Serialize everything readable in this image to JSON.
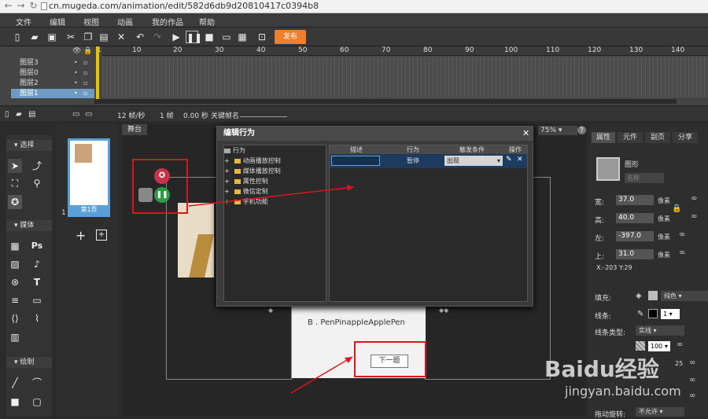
{
  "browser": {
    "url": "cn.mugeda.com/animation/edit/582d6db9d20810417c0394b8"
  },
  "menu": [
    "文件",
    "编辑",
    "视图",
    "动画",
    "我的作品",
    "帮助"
  ],
  "toolbar": {
    "publish": "发布"
  },
  "ruler": [
    "1",
    "10",
    "20",
    "30",
    "40",
    "50",
    "60",
    "70",
    "80",
    "90",
    "100",
    "110",
    "120",
    "130",
    "140"
  ],
  "layers": [
    "图层3",
    "图层0",
    "图层2",
    "图层1"
  ],
  "status": {
    "fps": "12 帧/秒",
    "frame": "1 帧",
    "time": "0.00 秒",
    "keyname": "关键帧名"
  },
  "left_panel": {
    "select": "选择",
    "media": "媒体",
    "draw": "绘制",
    "ps": "Ps"
  },
  "pages": {
    "label": "第1页",
    "index": "1"
  },
  "stage": {
    "tab": "舞台",
    "zoom": "75%",
    "option_b": "B . PenPinappleApplePen",
    "next": "下一题"
  },
  "dialog": {
    "title": "编辑行为",
    "tree": [
      "行为",
      "动画播放控制",
      "媒体播放控制",
      "属性控制",
      "微信定制",
      "手机功能"
    ],
    "columns": [
      "描述",
      "行为",
      "触发条件",
      "操作"
    ],
    "row": {
      "desc": "",
      "action": "暂停",
      "trigger": "出现"
    }
  },
  "right_panel": {
    "tabs": [
      "属性",
      "元件",
      "副页",
      "分享"
    ],
    "element_type": "图形",
    "name_placeholder": "名称",
    "fields": [
      {
        "label": "宽:",
        "value": "37.0",
        "unit": "像素"
      },
      {
        "label": "高:",
        "value": "40.0",
        "unit": "像素"
      },
      {
        "label": "左:",
        "value": "-397.0",
        "unit": "像素"
      },
      {
        "label": "上:",
        "value": "31.0",
        "unit": "像素"
      }
    ],
    "xy": "X:-203   Y:29",
    "fill_label": "填充:",
    "fill_type": "纯色",
    "stroke_label": "线条:",
    "stroke_width": "1",
    "stroke_type_label": "线条类型:",
    "stroke_type": "实线",
    "opacity": "100",
    "rotation_value": "25",
    "drag_label": "拖动旋转:",
    "drag_value": "不允许"
  },
  "watermark": {
    "brand": "Baidu经验",
    "site": "jingyan.baidu.com"
  },
  "colors": {
    "publish": "#ee7f2d",
    "selection": "#6e9bc4",
    "annotation": "#d9161d"
  }
}
